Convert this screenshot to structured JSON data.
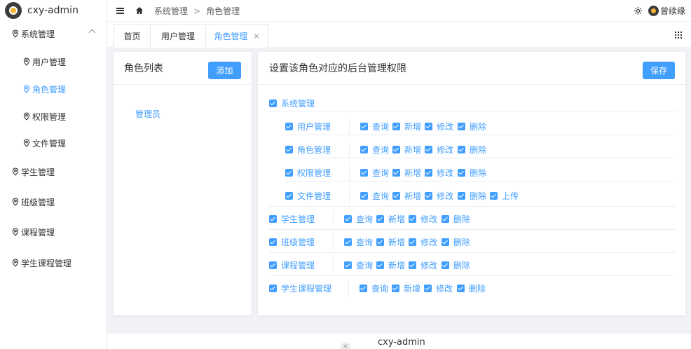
{
  "app": {
    "title": "cxy-admin"
  },
  "sidebar": {
    "items": [
      {
        "label": "系统管理",
        "level": 1,
        "expanded": true
      },
      {
        "label": "用户管理",
        "level": 2
      },
      {
        "label": "角色管理",
        "level": 2,
        "active": true
      },
      {
        "label": "权限管理",
        "level": 2
      },
      {
        "label": "文件管理",
        "level": 2
      },
      {
        "label": "学生管理",
        "level": 1
      },
      {
        "label": "班级管理",
        "level": 1
      },
      {
        "label": "课程管理",
        "level": 1
      },
      {
        "label": "学生课程管理",
        "level": 1
      }
    ]
  },
  "header": {
    "breadcrumb": [
      "系统管理",
      "角色管理"
    ],
    "separator": ">",
    "username": "曾续缘"
  },
  "tabs": [
    {
      "label": "首页"
    },
    {
      "label": "用户管理"
    },
    {
      "label": "角色管理",
      "active": true,
      "close": "×"
    }
  ],
  "roles_panel": {
    "title": "角色列表",
    "add_label": "添加",
    "roles": [
      "管理员"
    ]
  },
  "perm_panel": {
    "title": "设置该角色对应的后台管理权限",
    "save_label": "保存",
    "tree": [
      {
        "label": "系统管理",
        "children": [
          {
            "label": "用户管理",
            "ops": [
              "查询",
              "新增",
              "修改",
              "删除"
            ]
          },
          {
            "label": "角色管理",
            "ops": [
              "查询",
              "新增",
              "修改",
              "删除"
            ]
          },
          {
            "label": "权限管理",
            "ops": [
              "查询",
              "新增",
              "修改",
              "删除"
            ]
          },
          {
            "label": "文件管理",
            "ops": [
              "查询",
              "新增",
              "修改",
              "删除",
              "上传"
            ]
          }
        ]
      },
      {
        "label": "学生管理",
        "ops": [
          "查询",
          "新增",
          "修改",
          "删除"
        ]
      },
      {
        "label": "班级管理",
        "ops": [
          "查询",
          "新增",
          "修改",
          "删除"
        ]
      },
      {
        "label": "课程管理",
        "ops": [
          "查询",
          "新增",
          "修改",
          "删除"
        ]
      },
      {
        "label": "学生课程管理",
        "ops": [
          "查询",
          "新增",
          "修改",
          "删除"
        ]
      }
    ]
  },
  "footer": {
    "text": "cxy-admin",
    "close": "×"
  },
  "colors": {
    "accent": "#409eff",
    "background": "#f0f2f5"
  }
}
